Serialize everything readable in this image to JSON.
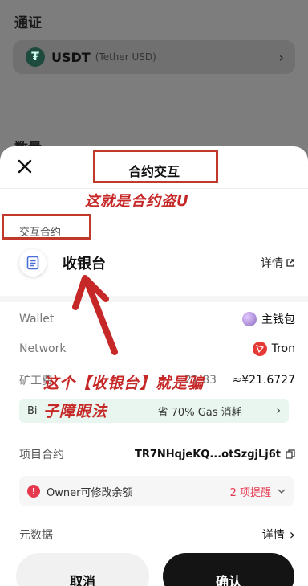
{
  "background": {
    "token_label": "通证",
    "token_symbol": "USDT",
    "token_full_name": "(Tether USD)",
    "amount_label": "数量"
  },
  "sheet": {
    "title": "合约交互",
    "interaction_label": "交互合约",
    "contract_name": "收银台",
    "details_label": "详情",
    "wallet_key": "Wallet",
    "wallet_value": "主钱包",
    "network_key": "Network",
    "network_value": "Tron",
    "fee_key": "矿工费",
    "fee_value_partial": "21.83",
    "fee_value_right": "≈¥21.6727",
    "gas_banner_prefix": "Bi",
    "gas_banner_text": "省 70% Gas 消耗",
    "project_contract_key": "项目合约",
    "project_contract_value": "TR7NHqjeKQ...otSzgjLj6t",
    "warning_text": "Owner可修改余额",
    "warning_count": "2 项提醒",
    "metadata_key": "元数据",
    "metadata_value": "详情",
    "cancel_label": "取消",
    "confirm_label": "确认"
  },
  "annotations": {
    "title_note": "这就是合约盗U",
    "blindfold_line1": "这个【收银台】就是骗",
    "blindfold_line2": "子障眼法",
    "annotation_color": "#c62828"
  },
  "icons": [
    "close-icon",
    "tether-icon",
    "chevron-right-icon",
    "document-icon",
    "external-link-icon",
    "wallet-avatar-icon",
    "tron-icon",
    "copy-icon",
    "warning-icon",
    "chevron-down-icon",
    "arrow-up-annotation-icon"
  ]
}
